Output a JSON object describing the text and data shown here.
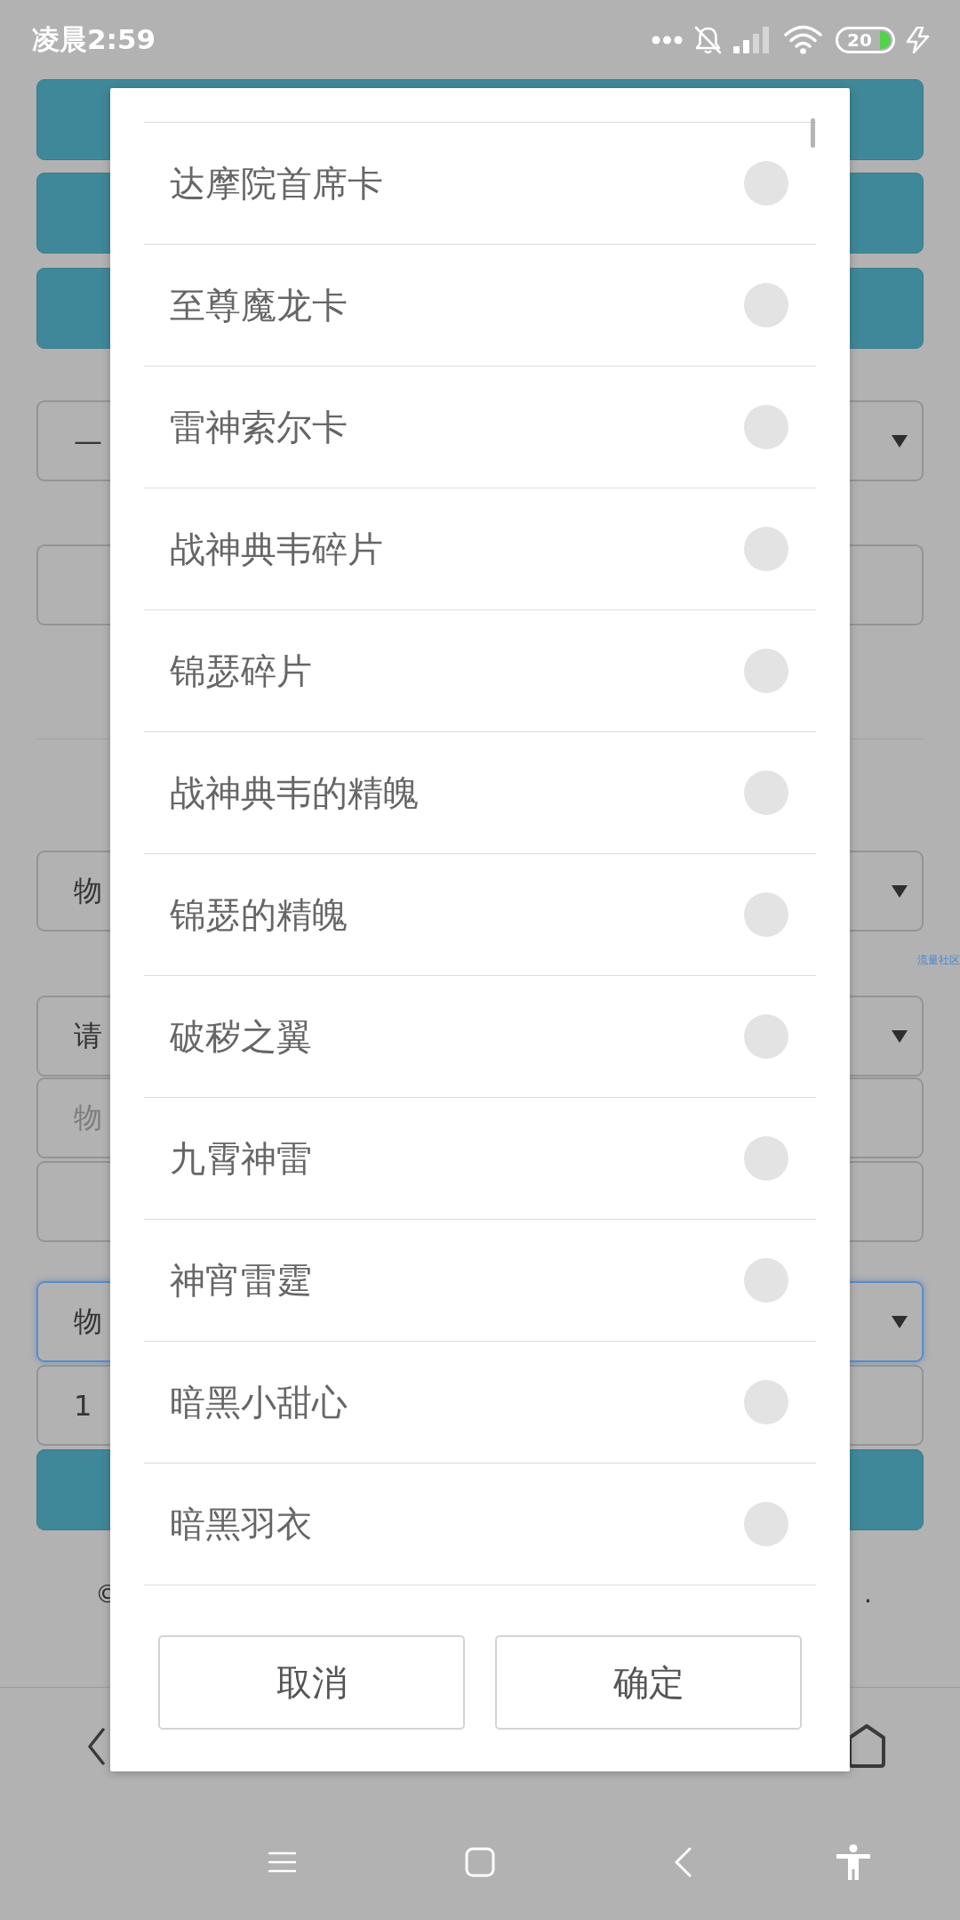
{
  "status_bar": {
    "time": "凌晨2:59",
    "battery": "20"
  },
  "page": {
    "fields": [
      {
        "kind": "button"
      },
      {
        "kind": "button"
      },
      {
        "kind": "button"
      },
      {
        "kind": "select",
        "value": "—",
        "focused": false
      },
      {
        "kind": "input",
        "focused": false
      },
      {
        "kind": "divider"
      },
      {
        "kind": "select",
        "value": "物",
        "focused": false
      },
      {
        "kind": "link",
        "text": "流量社区"
      },
      {
        "kind": "select",
        "value": "请",
        "focused": false
      },
      {
        "kind": "input",
        "placeholder": "物",
        "focused": false
      },
      {
        "kind": "input",
        "focused": false
      },
      {
        "kind": "select",
        "value": "物",
        "focused": true
      },
      {
        "kind": "input",
        "value": "1",
        "focused": false
      },
      {
        "kind": "button"
      }
    ],
    "footer": {
      "start": "©",
      "end": "."
    }
  },
  "dialog": {
    "options": [
      {
        "label": "达摩院首席卡",
        "selected": false
      },
      {
        "label": "至尊魔龙卡",
        "selected": false
      },
      {
        "label": "雷神索尔卡",
        "selected": false
      },
      {
        "label": "战神典韦碎片",
        "selected": false
      },
      {
        "label": "锦瑟碎片",
        "selected": false
      },
      {
        "label": "战神典韦的精魄",
        "selected": false
      },
      {
        "label": "锦瑟的精魄",
        "selected": false
      },
      {
        "label": "破秽之翼",
        "selected": false
      },
      {
        "label": "九霄神雷",
        "selected": false
      },
      {
        "label": "神宵雷霆",
        "selected": false
      },
      {
        "label": "暗黑小甜心",
        "selected": false
      },
      {
        "label": "暗黑羽衣",
        "selected": false
      }
    ],
    "buttons": [
      "取消",
      "确定"
    ]
  }
}
